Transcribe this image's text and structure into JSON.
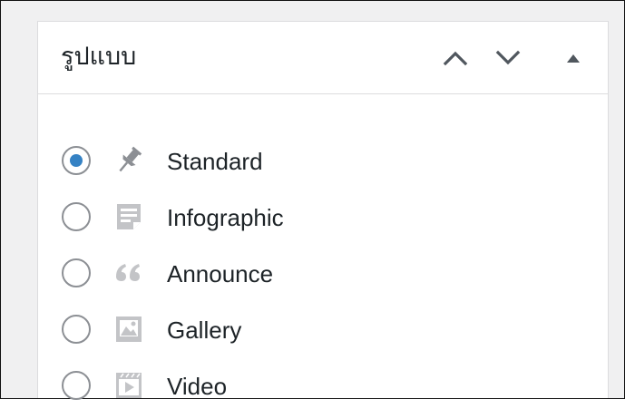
{
  "panel": {
    "title": "รูปแบบ",
    "move_up_label": "Move up",
    "move_down_label": "Move down",
    "toggle_label": "Toggle panel"
  },
  "formats": [
    {
      "label": "Standard",
      "icon": "pin-icon",
      "selected": true
    },
    {
      "label": "Infographic",
      "icon": "document-icon",
      "selected": false
    },
    {
      "label": "Announce",
      "icon": "quote-icon",
      "selected": false
    },
    {
      "label": "Gallery",
      "icon": "gallery-icon",
      "selected": false
    },
    {
      "label": "Video",
      "icon": "video-icon",
      "selected": false
    }
  ],
  "colors": {
    "radio_checked": "#3582c4",
    "icon_active": "#8c8f94",
    "icon_inactive": "#c3c4c7",
    "text": "#1d2327",
    "border": "#dcdcde"
  }
}
